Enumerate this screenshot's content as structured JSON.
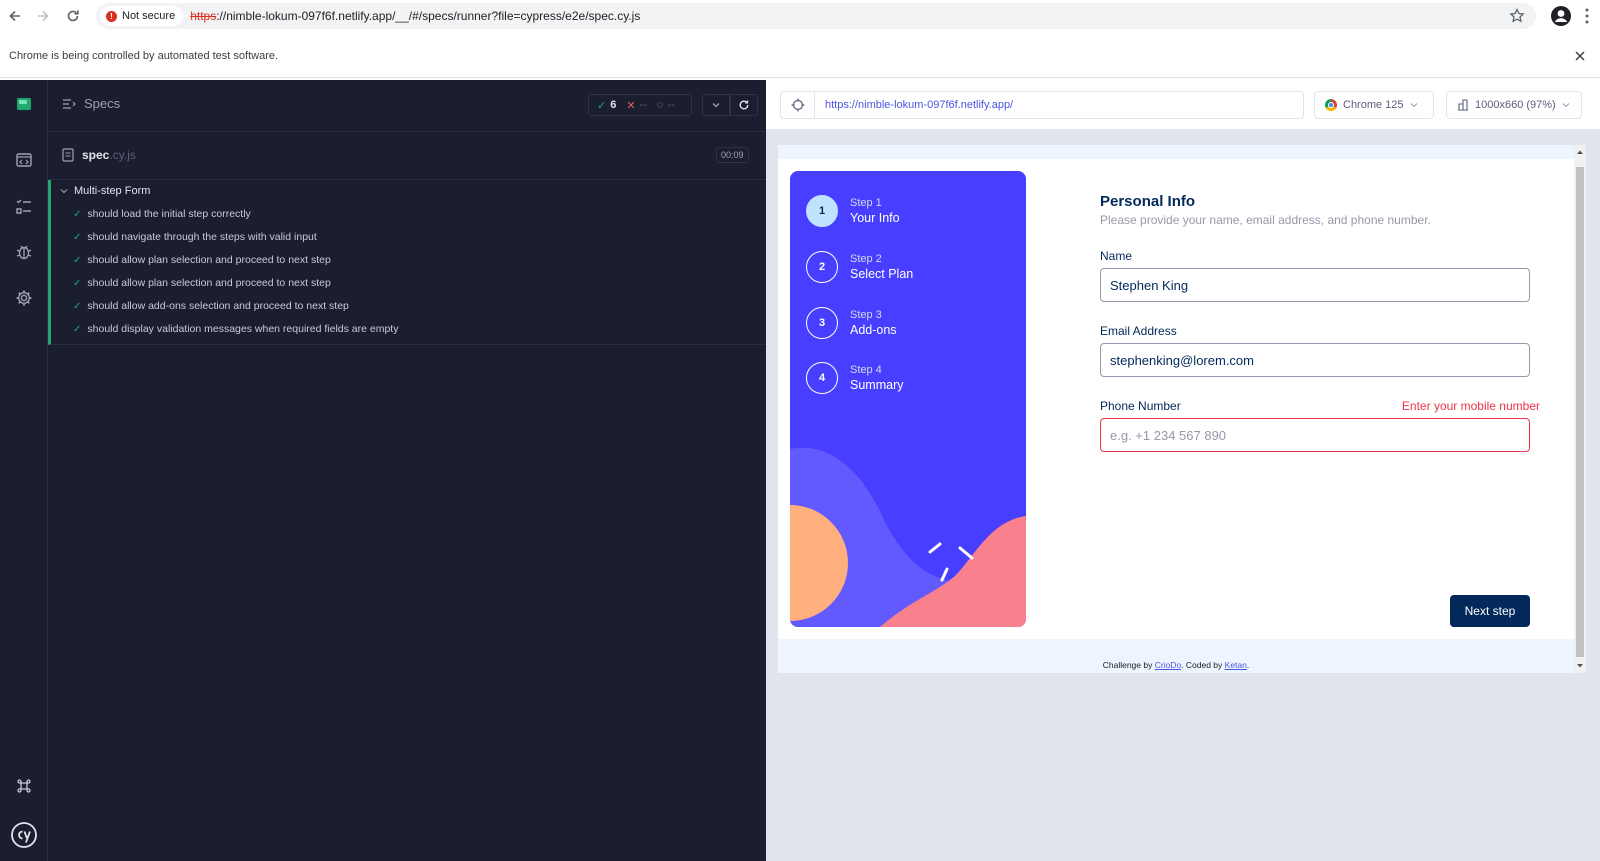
{
  "browser": {
    "security_label": "Not secure",
    "url_scheme": "https",
    "url_rest": "://nimble-lokum-097f6f.netlify.app/__/#/specs/runner?file=cypress/e2e/spec.cy.js",
    "infobar_text": "Chrome is being controlled by automated test software."
  },
  "reporter": {
    "header_label": "Specs",
    "stats": {
      "passed": "6",
      "failed": "--",
      "pending": "--"
    },
    "spec": {
      "name": "spec",
      "ext": ".cy.js",
      "duration": "00:09"
    },
    "suite_title": "Multi-step Form",
    "tests": [
      {
        "title": "should load the initial step correctly",
        "state": "passed"
      },
      {
        "title": "should navigate through the steps with valid input",
        "state": "passed"
      },
      {
        "title": "should allow plan selection and proceed to next step",
        "state": "passed"
      },
      {
        "title": "should allow plan selection and proceed to next step",
        "state": "passed"
      },
      {
        "title": "should allow add-ons selection and proceed to next step",
        "state": "passed"
      },
      {
        "title": "should display validation messages when required fields are empty",
        "state": "passed"
      }
    ]
  },
  "aut_toolbar": {
    "url": "https://nimble-lokum-097f6f.netlify.app/",
    "browser": "Chrome 125",
    "viewport": "1000x660 (97%)"
  },
  "app": {
    "steps": [
      {
        "number": "1",
        "label": "Step 1",
        "name": "Your Info",
        "active": true
      },
      {
        "number": "2",
        "label": "Step 2",
        "name": "Select Plan",
        "active": false
      },
      {
        "number": "3",
        "label": "Step 3",
        "name": "Add-ons",
        "active": false
      },
      {
        "number": "4",
        "label": "Step 4",
        "name": "Summary",
        "active": false
      }
    ],
    "title": "Personal Info",
    "subtitle": "Please provide your name, email address, and phone number.",
    "fields": {
      "name": {
        "label": "Name",
        "value": "Stephen King"
      },
      "email": {
        "label": "Email Address",
        "value": "stephenking@lorem.com"
      },
      "phone": {
        "label": "Phone Number",
        "placeholder": "e.g. +1 234 567 890",
        "error": "Enter your mobile number"
      }
    },
    "next_button": "Next step",
    "attribution": {
      "prefix": "Challenge by ",
      "link1": "CrioDo",
      "middle": ". Coded by ",
      "link2": "Ketan",
      "suffix": "."
    }
  },
  "colors": {
    "reporter_bg": "#1b1e2e",
    "pass_green": "#1fa971",
    "sidebar_purple": "#483eff",
    "marine_blue": "#02295a",
    "error_red": "#ed3548"
  }
}
